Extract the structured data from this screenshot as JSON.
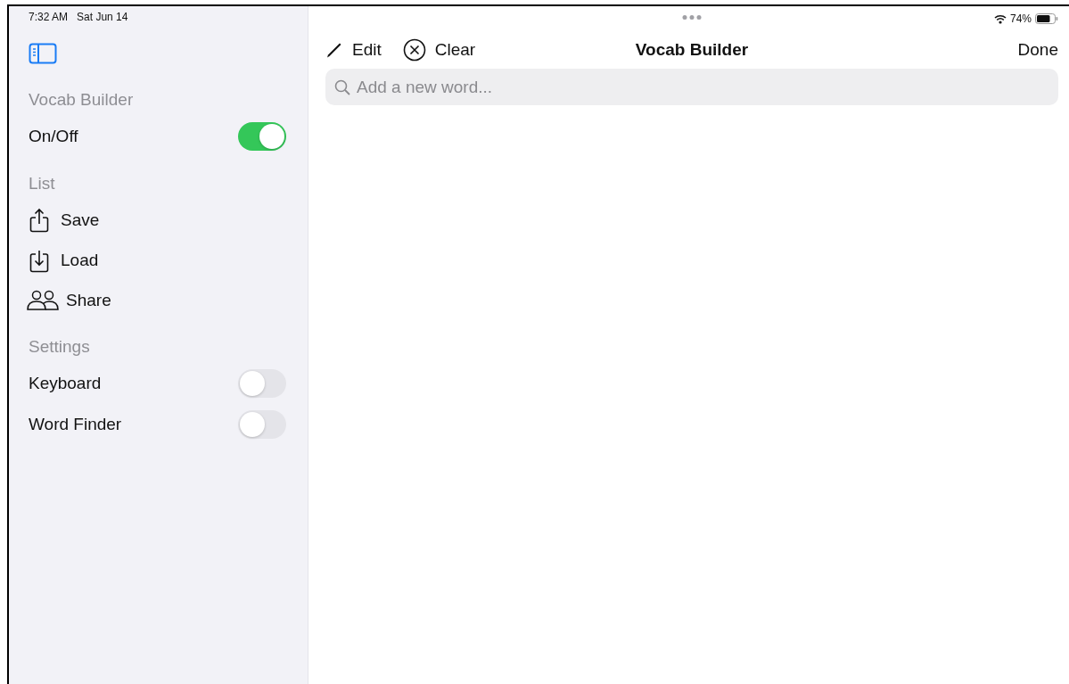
{
  "status_bar": {
    "time": "7:32 AM",
    "date": "Sat Jun 14",
    "battery": "74%"
  },
  "sidebar": {
    "sections": [
      {
        "title": "Vocab Builder",
        "items": [
          {
            "kind": "toggle",
            "label": "On/Off",
            "on": true
          }
        ]
      },
      {
        "title": "List",
        "items": [
          {
            "kind": "save",
            "label": "Save"
          },
          {
            "kind": "load",
            "label": "Load"
          },
          {
            "kind": "share",
            "label": "Share"
          }
        ]
      },
      {
        "title": "Settings",
        "items": [
          {
            "kind": "toggle",
            "label": "Keyboard",
            "on": false
          },
          {
            "kind": "toggle",
            "label": "Word Finder",
            "on": false
          }
        ]
      }
    ]
  },
  "toolbar": {
    "edit": "Edit",
    "clear": "Clear",
    "title": "Vocab Builder",
    "done": "Done"
  },
  "search": {
    "placeholder": "Add a new word..."
  }
}
